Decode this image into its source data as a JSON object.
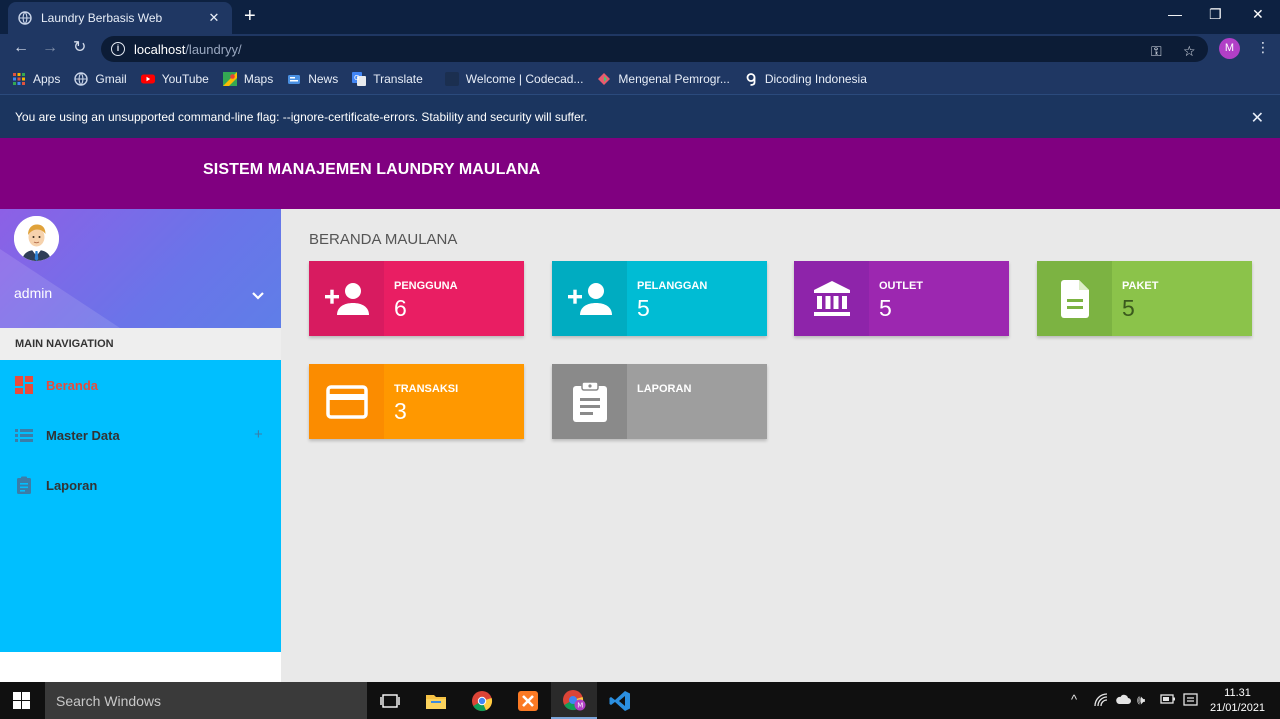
{
  "browser": {
    "tab_title": "Laundry Berbasis Web",
    "url_host": "localhost",
    "url_path": "/laundryy/",
    "profile_initial": "M",
    "bookmarks": [
      {
        "label": "Apps",
        "icon": "apps-grid-icon",
        "color": "#e0533f"
      },
      {
        "label": "Gmail",
        "icon": "globe-icon",
        "color": "#c9d4e8"
      },
      {
        "label": "YouTube",
        "icon": "youtube-icon",
        "color": "#ff0000"
      },
      {
        "label": "Maps",
        "icon": "maps-icon",
        "color": "#34a853"
      },
      {
        "label": "News",
        "icon": "news-icon",
        "color": "#4a90e2"
      },
      {
        "label": "Translate",
        "icon": "translate-icon",
        "color": "#4285f4"
      },
      {
        "label": "Welcome | Codecad...",
        "icon": "codecademy-icon",
        "color": "#1f3763"
      },
      {
        "label": "Mengenal Pemrogr...",
        "icon": "page-icon",
        "color": "#e95b6e"
      },
      {
        "label": "Dicoding Indonesia",
        "icon": "dicoding-icon",
        "color": "#ffffff"
      }
    ],
    "infobar_message": "You are using an unsupported command-line flag: --ignore-certificate-errors. Stability and security will suffer."
  },
  "app": {
    "brand": "SISTEM MANAJEMEN LAUNDRY MAULANA",
    "header_color": "#800080"
  },
  "sidebar": {
    "user_name": "admin",
    "nav_header": "MAIN NAVIGATION",
    "items": [
      {
        "label": "Beranda",
        "icon": "dashboard-icon",
        "active": true
      },
      {
        "label": "Master Data",
        "icon": "list-icon",
        "expand": "+"
      },
      {
        "label": "Laporan",
        "icon": "clipboard-icon"
      }
    ],
    "background": "#00bfff"
  },
  "content": {
    "title": "BERANDA MAULANA",
    "cards": [
      {
        "label": "PENGGUNA",
        "value": "6",
        "icon": "person-add-icon",
        "color": "#e91e63",
        "icon_bg": "#d81b60"
      },
      {
        "label": "PELANGGAN",
        "value": "5",
        "icon": "person-add-icon",
        "color": "#00bcd4",
        "icon_bg": "#00acc1"
      },
      {
        "label": "OUTLET",
        "value": "5",
        "icon": "bank-icon",
        "color": "#9c27b0",
        "icon_bg": "#8e24aa"
      },
      {
        "label": "PAKET",
        "value": "5",
        "icon": "document-icon",
        "color": "#8bc34a",
        "icon_bg": "#7cb342"
      },
      {
        "label": "TRANSAKSI",
        "value": "3",
        "icon": "credit-card-icon",
        "color": "#ff9800",
        "icon_bg": "#fb8c00"
      },
      {
        "label": "LAPORAN",
        "value": "",
        "icon": "clipboard-icon",
        "color": "#9e9e9e",
        "icon_bg": "#8a8a8a"
      }
    ]
  },
  "taskbar": {
    "search_placeholder": "Search Windows",
    "time": "11.31",
    "date": "21/01/2021"
  }
}
